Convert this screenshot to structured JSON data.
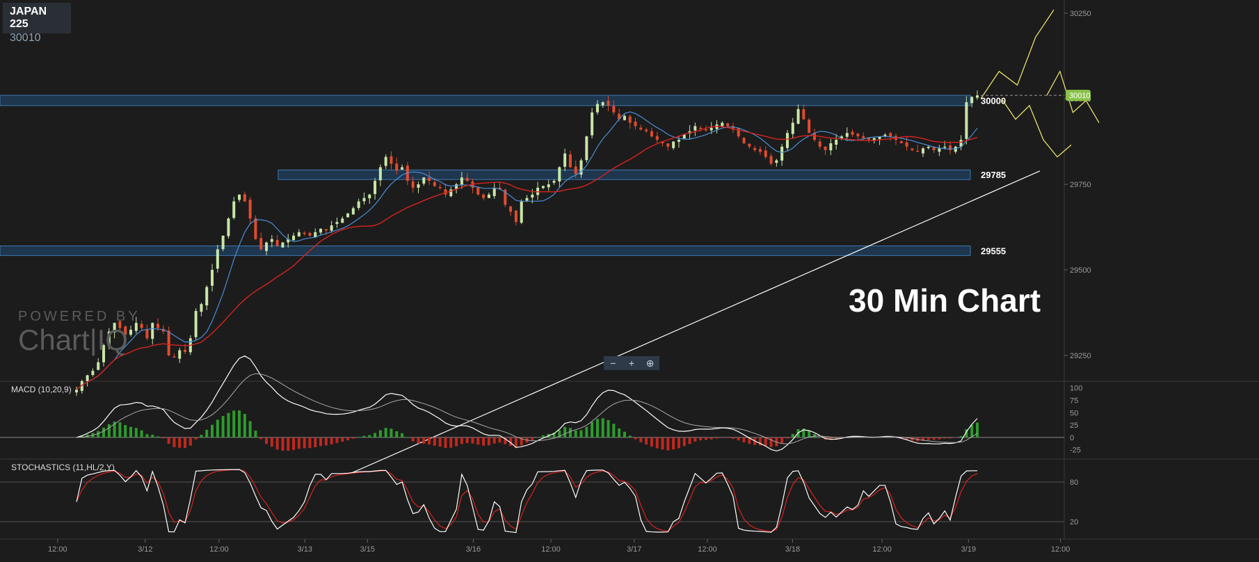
{
  "symbol": {
    "name": "JAPAN 225",
    "price": "30010"
  },
  "annotation": "30 Min Chart",
  "watermark": {
    "line1": "POWERED BY",
    "line2": "Chart|IQ"
  },
  "zoom_controls": {
    "zoom_out": "−",
    "zoom_in": "+",
    "reset": "⊕"
  },
  "colors": {
    "background": "#1c1c1c",
    "up_candle": "#c8e6a8",
    "down_candle": "#e24b2e",
    "zone_fill": "#1f3b57",
    "zone_border": "#3d7ab3",
    "ma_fast": "#4a90d9",
    "ma_slow": "#d8231f",
    "projection": "#e8e06a",
    "trendline": "#ffffff",
    "price_badge": "#8bc34a"
  },
  "chart_data": [
    {
      "type": "candlestick",
      "title": "JAPAN 225",
      "timeframe": "30 Min Chart",
      "ylim": [
        29150,
        30270
      ],
      "y_ticks": [
        29250,
        29500,
        29750,
        30000,
        30250
      ],
      "x_ticks": [
        "12:00",
        "3/12",
        "12:00",
        "3/13",
        "3/15",
        "3/16",
        "12:00",
        "3/17",
        "12:00",
        "3/18",
        "12:00",
        "3/19",
        "12:00"
      ],
      "current_price": 30010,
      "zones": [
        {
          "label": "30000",
          "low": 29980,
          "high": 30010
        },
        {
          "label": "29785",
          "low": 29764,
          "high": 29792
        },
        {
          "label": "29555",
          "low": 29542,
          "high": 29570
        }
      ],
      "close_path": [
        29150,
        29175,
        29192,
        29205,
        29230,
        29280,
        29320,
        29345,
        29330,
        29310,
        29325,
        29345,
        29330,
        29300,
        29345,
        29330,
        29320,
        29250,
        29245,
        29265,
        29260,
        29300,
        29380,
        29400,
        29450,
        29500,
        29560,
        29600,
        29650,
        29700,
        29720,
        29700,
        29650,
        29590,
        29560,
        29580,
        29590,
        29570,
        29580,
        29590,
        29600,
        29610,
        29605,
        29600,
        29610,
        29620,
        29615,
        29630,
        29640,
        29650,
        29665,
        29680,
        29700,
        29710,
        29720,
        29760,
        29800,
        29830,
        29810,
        29790,
        29800,
        29760,
        29740,
        29750,
        29770,
        29760,
        29745,
        29740,
        29720,
        29735,
        29750,
        29770,
        29760,
        29740,
        29720,
        29710,
        29720,
        29740,
        29735,
        29690,
        29670,
        29640,
        29700,
        29710,
        29720,
        29740,
        29745,
        29750,
        29760,
        29800,
        29840,
        29800,
        29780,
        29820,
        29890,
        29960,
        29985,
        29990,
        29980,
        29960,
        29940,
        29950,
        29930,
        29920,
        29910,
        29905,
        29890,
        29880,
        29870,
        29860,
        29875,
        29880,
        29895,
        29905,
        29920,
        29915,
        29910,
        29915,
        29925,
        29930,
        29920,
        29910,
        29890,
        29870,
        29860,
        29850,
        29845,
        29830,
        29810,
        29820,
        29860,
        29900,
        29930,
        29970,
        29940,
        29900,
        29880,
        29860,
        29850,
        29870,
        29880,
        29890,
        29900,
        29895,
        29890,
        29885,
        29880,
        29885,
        29890,
        29895,
        29890,
        29880,
        29870,
        29860,
        29850,
        29845,
        29855,
        29860,
        29850,
        29855,
        29860,
        29850,
        29860,
        29880,
        29990,
        30005,
        30010
      ],
      "projection_a": [
        30000,
        30080,
        30040,
        30180,
        30260
      ],
      "projection_b": [
        30000,
        29940,
        29980,
        29880,
        29830,
        29865
      ],
      "projection_c": [
        30010,
        30080,
        29960,
        29995,
        29930
      ],
      "trendline": {
        "start": 29150,
        "end": 29785
      }
    },
    {
      "type": "line",
      "title": "MACD (10,20,9)",
      "y_ticks": [
        100,
        75,
        50,
        25,
        0,
        -25
      ],
      "ylim": [
        -38,
        108
      ]
    },
    {
      "type": "line",
      "title": "STOCHASTICS (11,HL/2,Y)",
      "y_ticks": [
        80,
        20
      ],
      "ylim": [
        0,
        100
      ]
    }
  ]
}
